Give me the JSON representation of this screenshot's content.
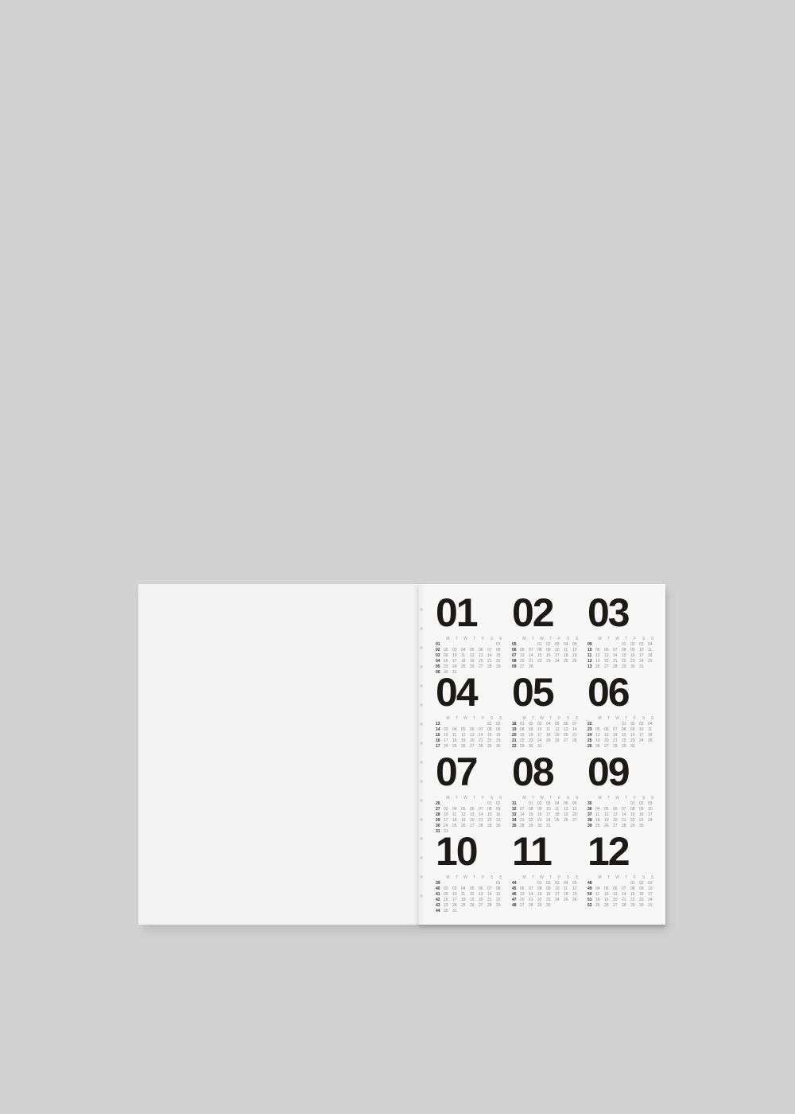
{
  "weekday_labels": [
    "M",
    "T",
    "W",
    "T",
    "F",
    "S",
    "S"
  ],
  "months": [
    {
      "label": "01",
      "weeks": [
        [
          "01",
          "",
          "",
          "",
          "",
          "",
          "",
          "01"
        ],
        [
          "02",
          "02",
          "03",
          "04",
          "05",
          "06",
          "07",
          "08"
        ],
        [
          "03",
          "09",
          "10",
          "11",
          "12",
          "13",
          "14",
          "15"
        ],
        [
          "04",
          "16",
          "17",
          "18",
          "19",
          "20",
          "21",
          "22"
        ],
        [
          "05",
          "23",
          "24",
          "25",
          "26",
          "27",
          "28",
          "29"
        ],
        [
          "06",
          "30",
          "31",
          "",
          "",
          "",
          "",
          ""
        ]
      ]
    },
    {
      "label": "02",
      "weeks": [
        [
          "05",
          "",
          "",
          "01",
          "02",
          "03",
          "04",
          "05"
        ],
        [
          "06",
          "06",
          "07",
          "08",
          "09",
          "10",
          "11",
          "12"
        ],
        [
          "07",
          "13",
          "14",
          "15",
          "16",
          "17",
          "18",
          "19"
        ],
        [
          "08",
          "20",
          "21",
          "22",
          "23",
          "24",
          "25",
          "26"
        ],
        [
          "09",
          "27",
          "28",
          "",
          "",
          "",
          "",
          ""
        ]
      ]
    },
    {
      "label": "03",
      "weeks": [
        [
          "09",
          "",
          "",
          "",
          "01",
          "02",
          "03",
          "04"
        ],
        [
          "10",
          "05",
          "06",
          "07",
          "08",
          "09",
          "10",
          "11"
        ],
        [
          "11",
          "12",
          "13",
          "14",
          "15",
          "16",
          "17",
          "18"
        ],
        [
          "12",
          "19",
          "20",
          "21",
          "22",
          "23",
          "24",
          "25"
        ],
        [
          "13",
          "26",
          "27",
          "28",
          "29",
          "30",
          "31",
          ""
        ]
      ]
    },
    {
      "label": "04",
      "weeks": [
        [
          "13",
          "",
          "",
          "",
          "",
          "",
          "01",
          "02"
        ],
        [
          "14",
          "03",
          "04",
          "05",
          "06",
          "07",
          "08",
          "09"
        ],
        [
          "15",
          "10",
          "11",
          "12",
          "13",
          "14",
          "15",
          "16"
        ],
        [
          "16",
          "17",
          "18",
          "19",
          "20",
          "21",
          "22",
          "23"
        ],
        [
          "17",
          "24",
          "25",
          "26",
          "27",
          "28",
          "29",
          "30"
        ]
      ]
    },
    {
      "label": "05",
      "weeks": [
        [
          "18",
          "01",
          "02",
          "03",
          "04",
          "05",
          "06",
          "07"
        ],
        [
          "19",
          "08",
          "09",
          "10",
          "11",
          "12",
          "13",
          "14"
        ],
        [
          "20",
          "15",
          "16",
          "17",
          "18",
          "19",
          "20",
          "21"
        ],
        [
          "21",
          "22",
          "23",
          "24",
          "25",
          "26",
          "27",
          "28"
        ],
        [
          "22",
          "29",
          "30",
          "31",
          "",
          "",
          "",
          ""
        ]
      ]
    },
    {
      "label": "06",
      "weeks": [
        [
          "22",
          "",
          "",
          "",
          "01",
          "02",
          "03",
          "04"
        ],
        [
          "23",
          "05",
          "06",
          "07",
          "08",
          "09",
          "10",
          "11"
        ],
        [
          "24",
          "12",
          "13",
          "14",
          "15",
          "16",
          "17",
          "18"
        ],
        [
          "25",
          "19",
          "20",
          "21",
          "22",
          "23",
          "24",
          "25"
        ],
        [
          "26",
          "26",
          "27",
          "28",
          "29",
          "30",
          "",
          ""
        ]
      ]
    },
    {
      "label": "07",
      "weeks": [
        [
          "26",
          "",
          "",
          "",
          "",
          "",
          "01",
          "02"
        ],
        [
          "27",
          "03",
          "04",
          "05",
          "06",
          "07",
          "08",
          "09"
        ],
        [
          "28",
          "10",
          "11",
          "12",
          "13",
          "14",
          "15",
          "16"
        ],
        [
          "29",
          "17",
          "18",
          "19",
          "20",
          "21",
          "22",
          "23"
        ],
        [
          "30",
          "24",
          "25",
          "26",
          "27",
          "28",
          "29",
          "30"
        ],
        [
          "31",
          "31",
          "",
          "",
          "",
          "",
          "",
          ""
        ]
      ]
    },
    {
      "label": "08",
      "weeks": [
        [
          "31",
          "",
          "01",
          "02",
          "03",
          "04",
          "05",
          "06"
        ],
        [
          "32",
          "07",
          "08",
          "09",
          "10",
          "11",
          "12",
          "13"
        ],
        [
          "33",
          "14",
          "15",
          "16",
          "17",
          "18",
          "19",
          "20"
        ],
        [
          "34",
          "21",
          "22",
          "23",
          "24",
          "25",
          "26",
          "27"
        ],
        [
          "35",
          "28",
          "29",
          "30",
          "31",
          "",
          "",
          ""
        ]
      ]
    },
    {
      "label": "09",
      "weeks": [
        [
          "35",
          "",
          "",
          "",
          "",
          "01",
          "02",
          "03"
        ],
        [
          "36",
          "04",
          "05",
          "06",
          "07",
          "08",
          "09",
          "10"
        ],
        [
          "37",
          "11",
          "12",
          "13",
          "14",
          "15",
          "16",
          "17"
        ],
        [
          "38",
          "18",
          "19",
          "20",
          "21",
          "22",
          "23",
          "24"
        ],
        [
          "39",
          "25",
          "26",
          "27",
          "28",
          "29",
          "30",
          ""
        ]
      ]
    },
    {
      "label": "10",
      "weeks": [
        [
          "39",
          "",
          "",
          "",
          "",
          "",
          "",
          "01"
        ],
        [
          "40",
          "02",
          "03",
          "04",
          "05",
          "06",
          "07",
          "08"
        ],
        [
          "41",
          "09",
          "10",
          "11",
          "12",
          "13",
          "14",
          "15"
        ],
        [
          "42",
          "16",
          "17",
          "18",
          "19",
          "20",
          "21",
          "22"
        ],
        [
          "43",
          "23",
          "24",
          "25",
          "26",
          "27",
          "28",
          "29"
        ],
        [
          "44",
          "30",
          "31",
          "",
          "",
          "",
          "",
          ""
        ]
      ]
    },
    {
      "label": "11",
      "weeks": [
        [
          "44",
          "",
          "",
          "01",
          "02",
          "03",
          "04",
          "05"
        ],
        [
          "45",
          "06",
          "07",
          "08",
          "09",
          "10",
          "11",
          "12"
        ],
        [
          "46",
          "13",
          "14",
          "15",
          "16",
          "17",
          "18",
          "19"
        ],
        [
          "47",
          "20",
          "21",
          "22",
          "23",
          "24",
          "25",
          "26"
        ],
        [
          "48",
          "27",
          "28",
          "29",
          "30",
          "",
          "",
          ""
        ]
      ]
    },
    {
      "label": "12",
      "weeks": [
        [
          "48",
          "",
          "",
          "",
          "",
          "01",
          "02",
          "03"
        ],
        [
          "49",
          "04",
          "05",
          "06",
          "07",
          "08",
          "09",
          "10"
        ],
        [
          "50",
          "11",
          "12",
          "13",
          "14",
          "15",
          "16",
          "17"
        ],
        [
          "51",
          "18",
          "19",
          "20",
          "21",
          "22",
          "23",
          "24"
        ],
        [
          "52",
          "25",
          "26",
          "27",
          "28",
          "29",
          "30",
          "31"
        ]
      ]
    }
  ],
  "colors": {
    "background": "#d2d2d2",
    "paper": "#f5f5f5",
    "ink": "#1c1a16"
  }
}
